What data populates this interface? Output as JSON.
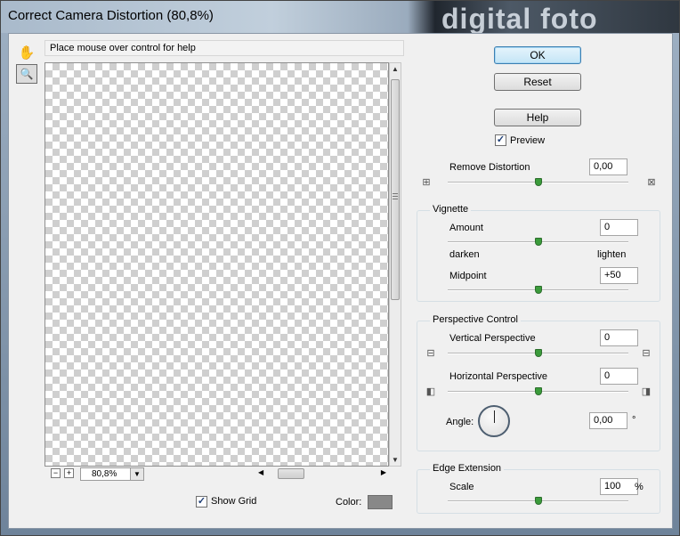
{
  "window": {
    "title": "Correct Camera Distortion (80,8%)",
    "background_text": "digital foto"
  },
  "tools": [
    {
      "name": "hand",
      "icon": "hand-icon",
      "glyph": "✋"
    },
    {
      "name": "zoom",
      "icon": "magnifier-icon",
      "glyph": "🔍"
    }
  ],
  "help_text": "Place mouse over control for help",
  "zoom": {
    "value": "80,8%",
    "minus": "−",
    "plus": "+"
  },
  "show_grid": {
    "label": "Show Grid",
    "checked": true
  },
  "color": {
    "label": "Color:",
    "value": "#888888"
  },
  "buttons": {
    "ok": "OK",
    "reset": "Reset",
    "help": "Help"
  },
  "preview": {
    "label": "Preview",
    "checked": true
  },
  "remove_distortion": {
    "label": "Remove Distortion",
    "value": "0,00",
    "slider_fraction": 0.5
  },
  "vignette": {
    "title": "Vignette",
    "amount": {
      "label": "Amount",
      "value": "0",
      "slider_fraction": 0.5,
      "left_label": "darken",
      "right_label": "lighten"
    },
    "midpoint": {
      "label": "Midpoint",
      "value": "+50",
      "slider_fraction": 0.5
    }
  },
  "perspective": {
    "title": "Perspective Control",
    "vertical": {
      "label": "Vertical Perspective",
      "value": "0",
      "slider_fraction": 0.5
    },
    "horizontal": {
      "label": "Horizontal Perspective",
      "value": "0",
      "slider_fraction": 0.5
    },
    "angle": {
      "label": "Angle:",
      "value": "0,00",
      "unit": "°"
    }
  },
  "edge": {
    "title": "Edge Extension",
    "scale": {
      "label": "Scale",
      "value": "100",
      "unit": "%",
      "slider_fraction": 0.5
    }
  }
}
